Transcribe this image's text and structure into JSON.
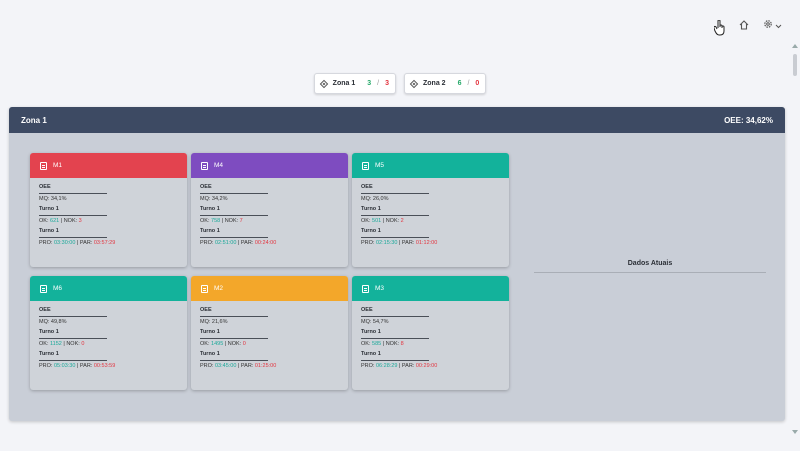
{
  "header": {
    "icons": [
      "pointer-hand-icon",
      "home-icon",
      "gear-icon",
      "chevron-down-icon"
    ]
  },
  "zones": [
    {
      "label": "Zona 1",
      "ok": "3",
      "nok": "3"
    },
    {
      "label": "Zona 2",
      "ok": "6",
      "nok": "0"
    }
  ],
  "panel": {
    "title": "Zona 1",
    "oee": "OEE: 34,62%"
  },
  "colors": {
    "red": "#e3434f",
    "purple": "#7e4cc0",
    "teal": "#13b29b",
    "orange": "#f3a72a"
  },
  "machines": [
    {
      "name": "M1",
      "color": "#e3434f",
      "oee_title": "OEE",
      "mq": "MQ: 34,1%",
      "turno": "Turno 1",
      "ok": "621",
      "nok": "3",
      "turno2": "Turno 1",
      "pro": "03:30:00",
      "par": "03:57:29"
    },
    {
      "name": "M4",
      "color": "#7e4cc0",
      "oee_title": "OEE",
      "mq": "MQ: 34,2%",
      "turno": "Turno 1",
      "ok": "758",
      "nok": "7",
      "turno2": "Turno 1",
      "pro": "02:51:00",
      "par": "00:24:00"
    },
    {
      "name": "M5",
      "color": "#13b29b",
      "oee_title": "OEE",
      "mq": "MQ: 26,0%",
      "turno": "Turno 1",
      "ok": "501",
      "nok": "2",
      "turno2": "Turno 1",
      "pro": "02:15:30",
      "par": "01:12:00"
    },
    {
      "name": "M6",
      "color": "#13b29b",
      "oee_title": "OEE",
      "mq": "MQ: 49,8%",
      "turno": "Turno 1",
      "ok": "1152",
      "nok": "0",
      "turno2": "Turno 1",
      "pro": "05:03:30",
      "par": "00:53:59"
    },
    {
      "name": "M2",
      "color": "#f3a72a",
      "oee_title": "OEE",
      "mq": "MQ: 21,6%",
      "turno": "Turno 1",
      "ok": "1495",
      "nok": "0",
      "turno2": "Turno 1",
      "pro": "03:45:00",
      "par": "01:25:00"
    },
    {
      "name": "M3",
      "color": "#13b29b",
      "oee_title": "OEE",
      "mq": "MQ: 54,7%",
      "turno": "Turno 1",
      "ok": "585",
      "nok": "8",
      "turno2": "Turno 1",
      "pro": "06:28:29",
      "par": "00:29:00"
    }
  ],
  "labels": {
    "ok": "OK: ",
    "nok": " | NOK: ",
    "pro": "PRO: ",
    "par": " | PAR: "
  },
  "dados_atuais": "Dados Atuais"
}
